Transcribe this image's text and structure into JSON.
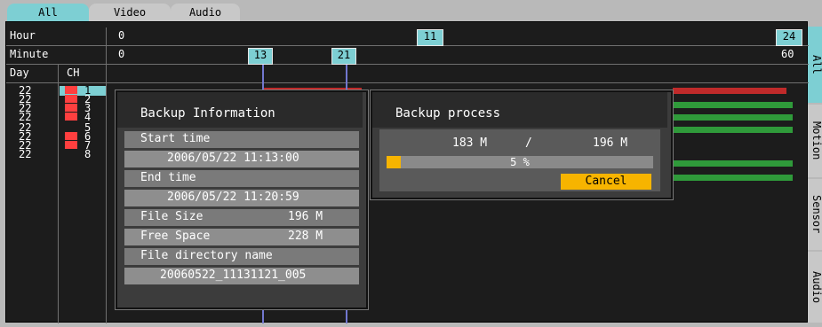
{
  "tabs": [
    "All",
    "Video",
    "Audio"
  ],
  "side_tabs": [
    "All",
    "Motion",
    "Sensor",
    "Audio"
  ],
  "timeline": {
    "hour_label": "Hour",
    "hour_start": "0",
    "hour_marker": "11",
    "hour_end": "24",
    "minute_label": "Minute",
    "minute_start": "0",
    "minute_marker_1": "13",
    "minute_marker_2": "21",
    "minute_end": "60",
    "day_label": "Day",
    "ch_label": "CH"
  },
  "channels": [
    {
      "day": "22",
      "ch": "1"
    },
    {
      "day": "22",
      "ch": "2"
    },
    {
      "day": "22",
      "ch": "3"
    },
    {
      "day": "22",
      "ch": "4"
    },
    {
      "day": "22",
      "ch": "5"
    },
    {
      "day": "22",
      "ch": "6"
    },
    {
      "day": "22",
      "ch": "7"
    },
    {
      "day": "22",
      "ch": "8"
    }
  ],
  "backup_info": {
    "title": "Backup Information",
    "start_time_label": "Start time",
    "start_time": "2006/05/22  11:13:00",
    "end_time_label": "End time",
    "end_time": "2006/05/22  11:20:59",
    "file_size_label": "File Size",
    "file_size": "196 M",
    "free_space_label": "Free Space",
    "free_space": "228 M",
    "dir_label": "File directory name",
    "dir_name": "20060522_11131121_005"
  },
  "backup_process": {
    "title": "Backup process",
    "done": "183 M",
    "separator": "/",
    "total": "196 M",
    "percent_text": "5 %",
    "progress": 0.05,
    "cancel_label": "Cancel"
  },
  "colors": {
    "marker": "#7dcfd3",
    "record_red": "#c02a2a",
    "record_green": "#2f9a3a",
    "cancel": "#f7b400"
  }
}
